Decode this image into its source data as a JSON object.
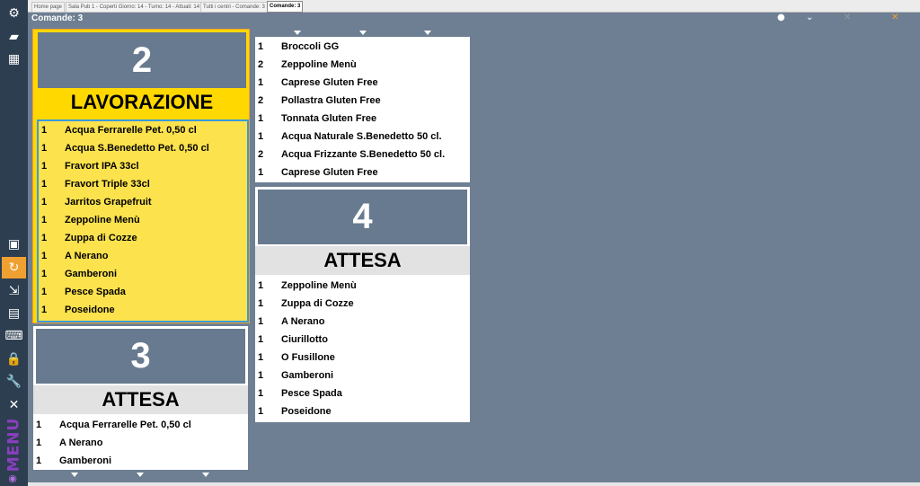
{
  "sidebar": {
    "items": [
      {
        "name": "settings-icon",
        "glyph": "⚙"
      },
      {
        "name": "printer-icon",
        "glyph": "▰"
      },
      {
        "name": "dashboard-icon",
        "glyph": "▦"
      },
      {
        "name": "save-icon",
        "glyph": "▣"
      },
      {
        "name": "refresh-icon",
        "glyph": "↻"
      },
      {
        "name": "export-icon",
        "glyph": "⇲"
      },
      {
        "name": "calculator-icon",
        "glyph": "▤"
      },
      {
        "name": "keyboard-icon",
        "glyph": "⌨"
      },
      {
        "name": "lock-icon",
        "glyph": "🔒"
      },
      {
        "name": "wrench-icon",
        "glyph": "🔧"
      },
      {
        "name": "close-icon",
        "glyph": "✕"
      }
    ],
    "menu_label": "MENU",
    "fingerprint_glyph": "◉"
  },
  "tabs": [
    "Home page",
    "Sala Pub 1 - Coperti Giorno: 14 - Turno: 14 - Attuali: 14",
    "Tutti i centri - Comande: 3",
    "Comande: 3"
  ],
  "header": {
    "title": "Comande: 3",
    "icons": [
      {
        "name": "circle-icon",
        "glyph": "●"
      },
      {
        "name": "chevron-down-icon",
        "glyph": "⌄"
      },
      {
        "name": "no-sound-icon",
        "glyph": "✕"
      },
      {
        "name": "close-icon",
        "glyph": "✕"
      }
    ]
  },
  "colors": {
    "accent": "#f0a030",
    "active_card": "#ffd800",
    "active_list": "#fce24d",
    "waiting": "#e2e2e2",
    "slate": "#677a8f"
  },
  "orders": [
    {
      "number": "2",
      "status": "LAVORAZIONE",
      "items": [
        {
          "qty": "1",
          "name": "Acqua Ferrarelle Pet. 0,50 cl"
        },
        {
          "qty": "1",
          "name": "Acqua S.Benedetto Pet. 0,50 cl"
        },
        {
          "qty": "1",
          "name": "Fravort IPA 33cl"
        },
        {
          "qty": "1",
          "name": "Fravort Triple 33cl"
        },
        {
          "qty": "1",
          "name": "Jarritos Grapefruit"
        },
        {
          "qty": "1",
          "name": "Zeppoline Menù"
        },
        {
          "qty": "1",
          "name": "Zuppa di Cozze"
        },
        {
          "qty": "1",
          "name": "A Nerano"
        },
        {
          "qty": "1",
          "name": "Gamberoni"
        },
        {
          "qty": "1",
          "name": "Pesce Spada"
        },
        {
          "qty": "1",
          "name": "Poseidone"
        }
      ]
    },
    {
      "number": "3",
      "status": "ATTESA",
      "items": [
        {
          "qty": "1",
          "name": "Acqua Ferrarelle Pet. 0,50 cl"
        },
        {
          "qty": "1",
          "name": "A Nerano"
        },
        {
          "qty": "1",
          "name": "Gamberoni"
        }
      ]
    },
    {
      "number": "",
      "status": "",
      "items": [
        {
          "qty": "1",
          "name": "Broccoli GG"
        },
        {
          "qty": "2",
          "name": "Zeppoline Menù"
        },
        {
          "qty": "1",
          "name": "Caprese Gluten Free"
        },
        {
          "qty": "2",
          "name": "Pollastra Gluten Free"
        },
        {
          "qty": "1",
          "name": "Tonnata Gluten Free"
        },
        {
          "qty": "1",
          "name": "Acqua Naturale S.Benedetto 50 cl."
        },
        {
          "qty": "2",
          "name": "Acqua Frizzante S.Benedetto 50 cl."
        },
        {
          "qty": "1",
          "name": "Caprese Gluten Free"
        }
      ]
    },
    {
      "number": "4",
      "status": "ATTESA",
      "items": [
        {
          "qty": "1",
          "name": "Zeppoline Menù"
        },
        {
          "qty": "1",
          "name": "Zuppa di Cozze"
        },
        {
          "qty": "1",
          "name": "A Nerano"
        },
        {
          "qty": "1",
          "name": "Ciurillotto"
        },
        {
          "qty": "1",
          "name": "O Fusillone"
        },
        {
          "qty": "1",
          "name": "Gamberoni"
        },
        {
          "qty": "1",
          "name": "Pesce Spada"
        },
        {
          "qty": "1",
          "name": "Poseidone"
        }
      ]
    }
  ]
}
